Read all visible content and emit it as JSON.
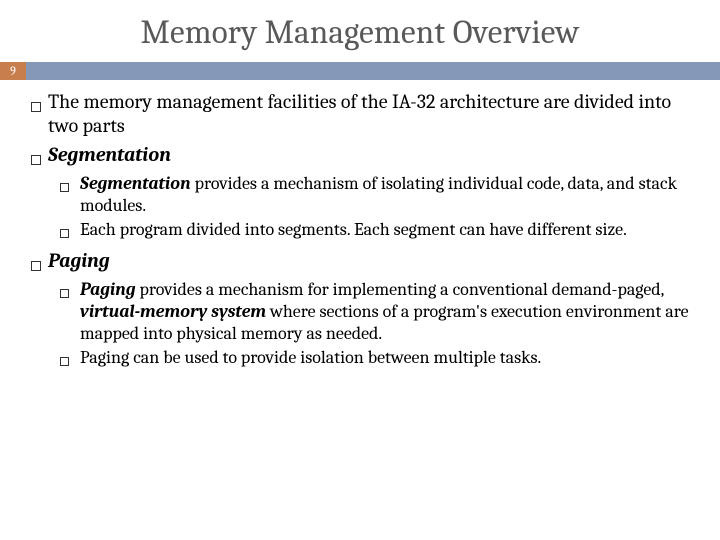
{
  "pageNumber": "9",
  "title": "Memory Management Overview",
  "bullets": {
    "b1_text": "The memory management facilities of the IA-32 architecture are divided into two parts",
    "b2_text": "Segmentation",
    "b2_sub1_lead": "Segmentation",
    "b2_sub1_rest": " provides a mechanism of isolating individual code, data, and stack modules.",
    "b2_sub2": "Each program divided into segments. Each segment can have different size.",
    "b3_text": "Paging",
    "b3_sub1_lead": "Paging",
    "b3_sub1_mid": " provides a mechanism for implementing a conventional demand-paged, ",
    "b3_sub1_vm": "virtual-memory system",
    "b3_sub1_end": " where sections of a program's execution environment are mapped into physical memory as needed.",
    "b3_sub2": "Paging can be used to provide isolation between multiple tasks."
  }
}
